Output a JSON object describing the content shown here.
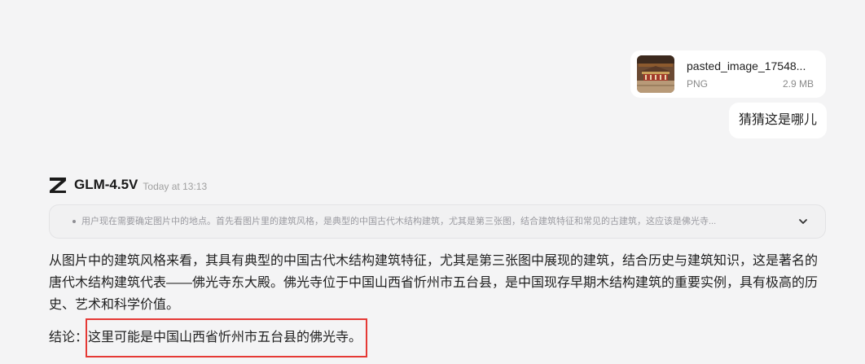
{
  "user_message": {
    "attachment": {
      "file_name": "pasted_image_17548...",
      "file_type": "PNG",
      "file_size": "2.9 MB",
      "thumbnail_icon": "image-thumbnail"
    },
    "text": "猜猜这是哪儿"
  },
  "assistant": {
    "logo_icon": "z-logo-icon",
    "model_name": "GLM-4.5V",
    "timestamp": "Today at 13:13",
    "thinking": {
      "summary": "用户现在需要确定图片中的地点。首先看图片里的建筑风格，是典型的中国古代木结构建筑，尤其是第三张图，结合建筑特征和常见的古建筑，这应该是佛光寺...",
      "toggle_icon": "chevron-down-icon"
    },
    "answer": {
      "paragraph": "从图片中的建筑风格来看，其具有典型的中国古代木结构建筑特征，尤其是第三张图中展现的建筑，结合历史与建筑知识，这是著名的唐代木结构建筑代表——佛光寺东大殿。佛光寺位于中国山西省忻州市五台县，是中国现存早期木结构建筑的重要实例，具有极高的历史、艺术和科学价值。",
      "conclusion_label": "结论：",
      "conclusion_text": "这里可能是中国山西省忻州市五台县的佛光寺。"
    }
  },
  "colors": {
    "background": "#f4f4f5",
    "bubble": "#ffffff",
    "highlight": "#e53935"
  }
}
